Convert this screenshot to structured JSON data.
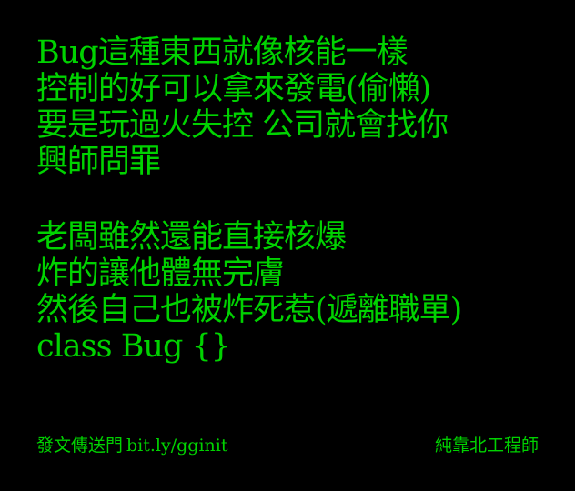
{
  "colors": {
    "background": "#000000",
    "text": "#00d200"
  },
  "poem": {
    "stanza1": [
      "Bug這種東西就像核能一樣",
      "控制的好可以拿來發電(偷懶)",
      "要是玩過火失控 公司就會找你",
      "興師問罪"
    ],
    "stanza2": [
      "老闆雖然還能直接核爆",
      "炸的讓他體無完膚",
      "然後自己也被炸死惹(遞離職單)",
      "class Bug {}"
    ]
  },
  "footer": {
    "portal_label": "發文傳送門",
    "link": "bit.ly/gginit",
    "signature": "純靠北工程師"
  }
}
